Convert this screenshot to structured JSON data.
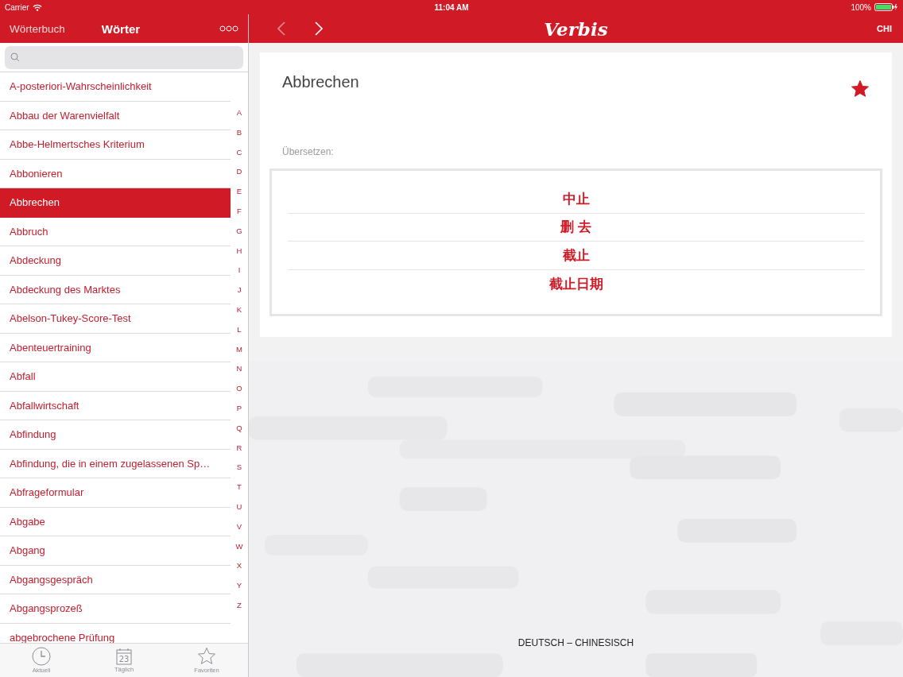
{
  "status_bar": {
    "carrier": "Carrier",
    "time": "11:04 AM",
    "battery": "100%",
    "level": 1
  },
  "sidebar": {
    "back_label": "Wörterbuch",
    "title": "Wörter",
    "words": [
      {
        "text": "A-posteriori-Wahrscheinlichkeit",
        "selected": false
      },
      {
        "text": "Abbau der Warenvielfalt",
        "selected": false
      },
      {
        "text": "Abbe-Helmertsches Kriterium",
        "selected": false
      },
      {
        "text": "Abbonieren",
        "selected": false
      },
      {
        "text": "Abbrechen",
        "selected": true
      },
      {
        "text": "Abbruch",
        "selected": false
      },
      {
        "text": "Abdeckung",
        "selected": false
      },
      {
        "text": "Abdeckung des Marktes",
        "selected": false
      },
      {
        "text": "Abelson-Tukey-Score-Test",
        "selected": false
      },
      {
        "text": "Abenteuertraining",
        "selected": false
      },
      {
        "text": "Abfall",
        "selected": false
      },
      {
        "text": "Abfallwirtschaft",
        "selected": false
      },
      {
        "text": "Abfindung",
        "selected": false
      },
      {
        "text": "Abfindung, die in einem zugelassenen Sp…",
        "selected": false
      },
      {
        "text": "Abfrageformular",
        "selected": false
      },
      {
        "text": "Abgabe",
        "selected": false
      },
      {
        "text": "Abgang",
        "selected": false
      },
      {
        "text": "Abgangsgespräch",
        "selected": false
      },
      {
        "text": "Abgangsprozeß",
        "selected": false
      },
      {
        "text": "abgebrochene Prüfung",
        "selected": false
      }
    ],
    "index": [
      "A",
      "B",
      "C",
      "D",
      "E",
      "F",
      "G",
      "H",
      "I",
      "J",
      "K",
      "L",
      "M",
      "N",
      "O",
      "P",
      "Q",
      "R",
      "S",
      "T",
      "U",
      "V",
      "W",
      "X",
      "Y",
      "Z"
    ],
    "tabs": [
      {
        "kind": "clock",
        "label": "Aktuell",
        "selected": false
      },
      {
        "kind": "calendar",
        "label": "Täglich",
        "icon_text": "23",
        "selected": false
      },
      {
        "kind": "star",
        "label": "Favoriten",
        "selected": false
      }
    ]
  },
  "main": {
    "logo": "Verbis",
    "language": "CHI",
    "entry": {
      "word": "Abbrechen",
      "favorite": true,
      "translate_label": "Übersetzen:",
      "translations": [
        "中止",
        "删 去",
        "截止",
        "截止日期"
      ]
    },
    "direction": "DEUTSCH – CHINESISCH"
  }
}
